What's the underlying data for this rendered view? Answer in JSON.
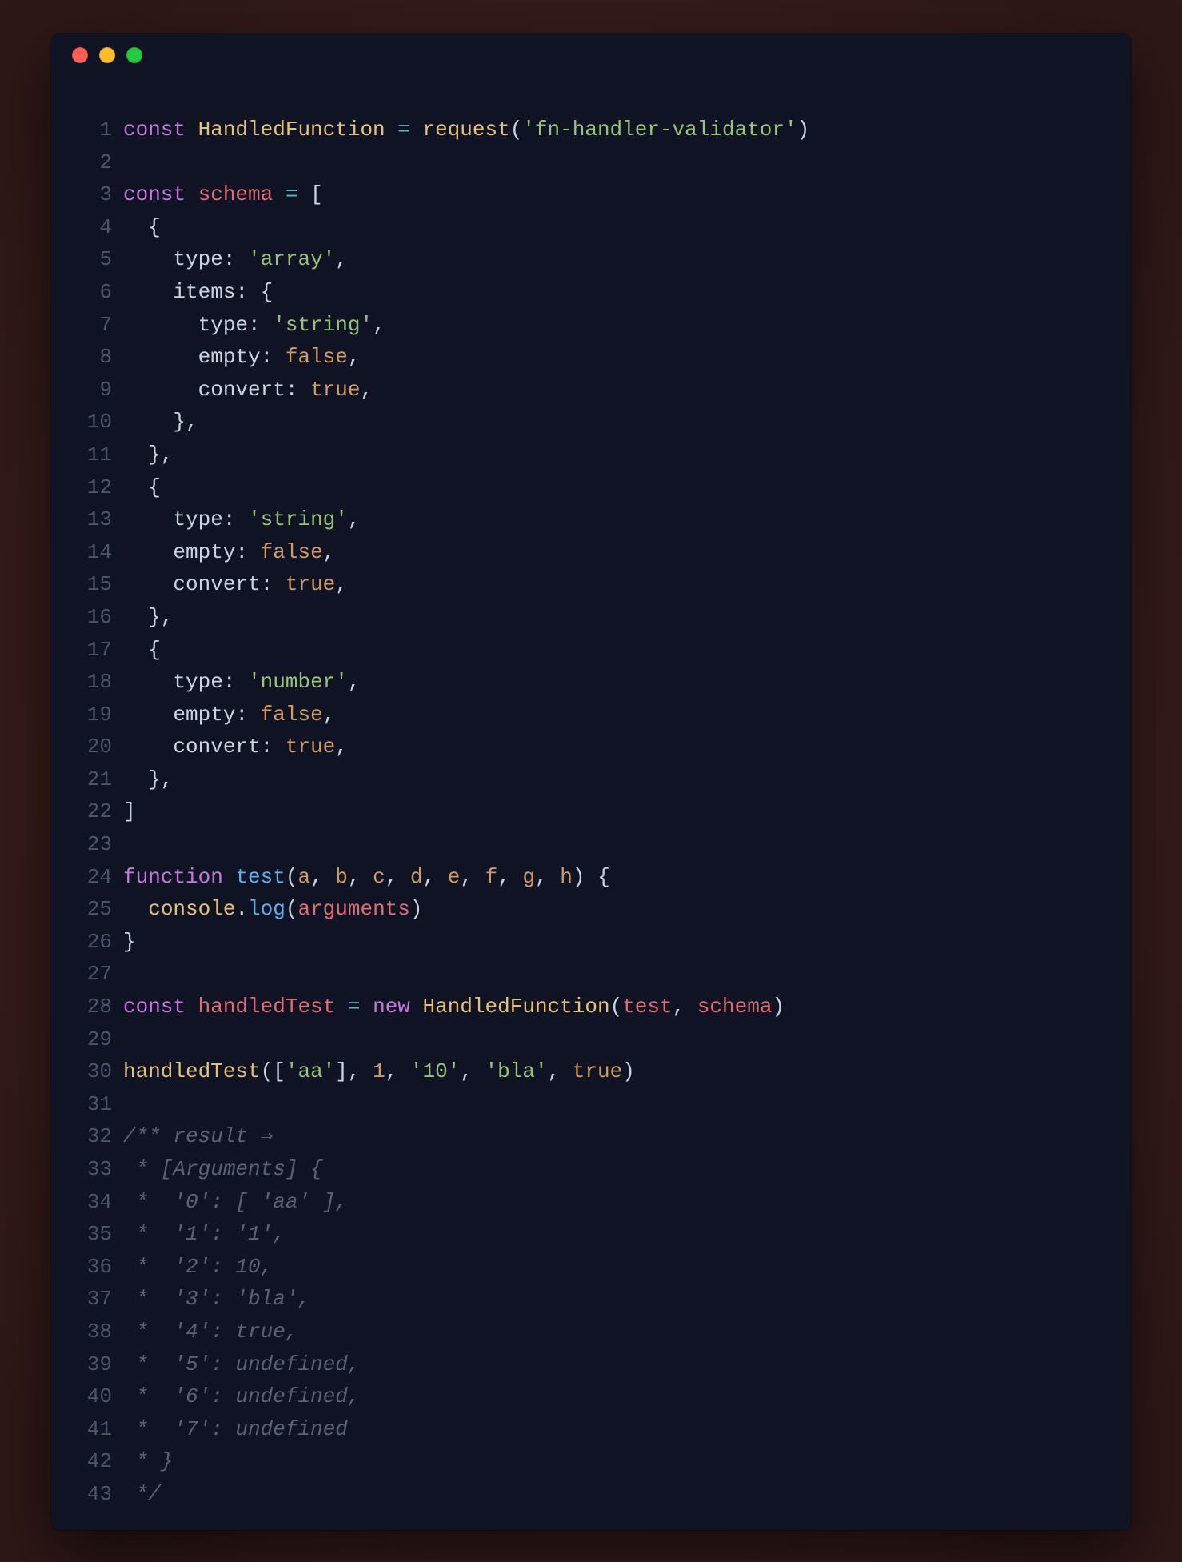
{
  "window": {
    "dots": [
      "red",
      "yellow",
      "green"
    ]
  },
  "code": {
    "lines": [
      {
        "n": "1",
        "tokens": [
          [
            "kw",
            "const"
          ],
          [
            "pun",
            " "
          ],
          [
            "cls",
            "HandledFunction"
          ],
          [
            "pun",
            " "
          ],
          [
            "op",
            "="
          ],
          [
            "pun",
            " "
          ],
          [
            "fncall",
            "request"
          ],
          [
            "pun",
            "("
          ],
          [
            "str",
            "'fn-handler-validator'"
          ],
          [
            "pun",
            ")"
          ]
        ]
      },
      {
        "n": "2",
        "tokens": []
      },
      {
        "n": "3",
        "tokens": [
          [
            "kw",
            "const"
          ],
          [
            "pun",
            " "
          ],
          [
            "var",
            "schema"
          ],
          [
            "pun",
            " "
          ],
          [
            "op",
            "="
          ],
          [
            "pun",
            " ["
          ]
        ]
      },
      {
        "n": "4",
        "tokens": [
          [
            "pun",
            "  {"
          ]
        ]
      },
      {
        "n": "5",
        "tokens": [
          [
            "pun",
            "    "
          ],
          [
            "prop",
            "type"
          ],
          [
            "pun",
            ": "
          ],
          [
            "str",
            "'array'"
          ],
          [
            "pun",
            ","
          ]
        ]
      },
      {
        "n": "6",
        "tokens": [
          [
            "pun",
            "    "
          ],
          [
            "prop",
            "items"
          ],
          [
            "pun",
            ": {"
          ]
        ]
      },
      {
        "n": "7",
        "tokens": [
          [
            "pun",
            "      "
          ],
          [
            "prop",
            "type"
          ],
          [
            "pun",
            ": "
          ],
          [
            "str",
            "'string'"
          ],
          [
            "pun",
            ","
          ]
        ]
      },
      {
        "n": "8",
        "tokens": [
          [
            "pun",
            "      "
          ],
          [
            "prop",
            "empty"
          ],
          [
            "pun",
            ": "
          ],
          [
            "bool",
            "false"
          ],
          [
            "pun",
            ","
          ]
        ]
      },
      {
        "n": "9",
        "tokens": [
          [
            "pun",
            "      "
          ],
          [
            "prop",
            "convert"
          ],
          [
            "pun",
            ": "
          ],
          [
            "bool",
            "true"
          ],
          [
            "pun",
            ","
          ]
        ]
      },
      {
        "n": "10",
        "tokens": [
          [
            "pun",
            "    },"
          ]
        ]
      },
      {
        "n": "11",
        "tokens": [
          [
            "pun",
            "  },"
          ]
        ]
      },
      {
        "n": "12",
        "tokens": [
          [
            "pun",
            "  {"
          ]
        ]
      },
      {
        "n": "13",
        "tokens": [
          [
            "pun",
            "    "
          ],
          [
            "prop",
            "type"
          ],
          [
            "pun",
            ": "
          ],
          [
            "str",
            "'string'"
          ],
          [
            "pun",
            ","
          ]
        ]
      },
      {
        "n": "14",
        "tokens": [
          [
            "pun",
            "    "
          ],
          [
            "prop",
            "empty"
          ],
          [
            "pun",
            ": "
          ],
          [
            "bool",
            "false"
          ],
          [
            "pun",
            ","
          ]
        ]
      },
      {
        "n": "15",
        "tokens": [
          [
            "pun",
            "    "
          ],
          [
            "prop",
            "convert"
          ],
          [
            "pun",
            ": "
          ],
          [
            "bool",
            "true"
          ],
          [
            "pun",
            ","
          ]
        ]
      },
      {
        "n": "16",
        "tokens": [
          [
            "pun",
            "  },"
          ]
        ]
      },
      {
        "n": "17",
        "tokens": [
          [
            "pun",
            "  {"
          ]
        ]
      },
      {
        "n": "18",
        "tokens": [
          [
            "pun",
            "    "
          ],
          [
            "prop",
            "type"
          ],
          [
            "pun",
            ": "
          ],
          [
            "str",
            "'number'"
          ],
          [
            "pun",
            ","
          ]
        ]
      },
      {
        "n": "19",
        "tokens": [
          [
            "pun",
            "    "
          ],
          [
            "prop",
            "empty"
          ],
          [
            "pun",
            ": "
          ],
          [
            "bool",
            "false"
          ],
          [
            "pun",
            ","
          ]
        ]
      },
      {
        "n": "20",
        "tokens": [
          [
            "pun",
            "    "
          ],
          [
            "prop",
            "convert"
          ],
          [
            "pun",
            ": "
          ],
          [
            "bool",
            "true"
          ],
          [
            "pun",
            ","
          ]
        ]
      },
      {
        "n": "21",
        "tokens": [
          [
            "pun",
            "  },"
          ]
        ]
      },
      {
        "n": "22",
        "tokens": [
          [
            "pun",
            "]"
          ]
        ]
      },
      {
        "n": "23",
        "tokens": []
      },
      {
        "n": "24",
        "tokens": [
          [
            "kw",
            "function"
          ],
          [
            "pun",
            " "
          ],
          [
            "fnName",
            "test"
          ],
          [
            "pun",
            "("
          ],
          [
            "arg",
            "a"
          ],
          [
            "pun",
            ", "
          ],
          [
            "arg",
            "b"
          ],
          [
            "pun",
            ", "
          ],
          [
            "arg",
            "c"
          ],
          [
            "pun",
            ", "
          ],
          [
            "arg",
            "d"
          ],
          [
            "pun",
            ", "
          ],
          [
            "arg",
            "e"
          ],
          [
            "pun",
            ", "
          ],
          [
            "arg",
            "f"
          ],
          [
            "pun",
            ", "
          ],
          [
            "arg",
            "g"
          ],
          [
            "pun",
            ", "
          ],
          [
            "arg",
            "h"
          ],
          [
            "pun",
            ") {"
          ]
        ]
      },
      {
        "n": "25",
        "tokens": [
          [
            "pun",
            "  "
          ],
          [
            "cls",
            "console"
          ],
          [
            "pun",
            "."
          ],
          [
            "fnName",
            "log"
          ],
          [
            "pun",
            "("
          ],
          [
            "builtin",
            "arguments"
          ],
          [
            "pun",
            ")"
          ]
        ]
      },
      {
        "n": "26",
        "tokens": [
          [
            "pun",
            "}"
          ]
        ]
      },
      {
        "n": "27",
        "tokens": []
      },
      {
        "n": "28",
        "tokens": [
          [
            "kw",
            "const"
          ],
          [
            "pun",
            " "
          ],
          [
            "var",
            "handledTest"
          ],
          [
            "pun",
            " "
          ],
          [
            "op",
            "="
          ],
          [
            "pun",
            " "
          ],
          [
            "kw",
            "new"
          ],
          [
            "pun",
            " "
          ],
          [
            "cls",
            "HandledFunction"
          ],
          [
            "pun",
            "("
          ],
          [
            "var",
            "test"
          ],
          [
            "pun",
            ", "
          ],
          [
            "var",
            "schema"
          ],
          [
            "pun",
            ")"
          ]
        ]
      },
      {
        "n": "29",
        "tokens": []
      },
      {
        "n": "30",
        "tokens": [
          [
            "fncall",
            "handledTest"
          ],
          [
            "pun",
            "(["
          ],
          [
            "str",
            "'aa'"
          ],
          [
            "pun",
            "], "
          ],
          [
            "num",
            "1"
          ],
          [
            "pun",
            ", "
          ],
          [
            "str",
            "'10'"
          ],
          [
            "pun",
            ", "
          ],
          [
            "str",
            "'bla'"
          ],
          [
            "pun",
            ", "
          ],
          [
            "bool",
            "true"
          ],
          [
            "pun",
            ")"
          ]
        ]
      },
      {
        "n": "31",
        "tokens": []
      },
      {
        "n": "32",
        "tokens": [
          [
            "cmt",
            "/** result ⇒"
          ]
        ]
      },
      {
        "n": "33",
        "tokens": [
          [
            "cmt",
            " * [Arguments] {"
          ]
        ]
      },
      {
        "n": "34",
        "tokens": [
          [
            "cmt",
            " *  '0': [ 'aa' ],"
          ]
        ]
      },
      {
        "n": "35",
        "tokens": [
          [
            "cmt",
            " *  '1': '1',"
          ]
        ]
      },
      {
        "n": "36",
        "tokens": [
          [
            "cmt",
            " *  '2': 10,"
          ]
        ]
      },
      {
        "n": "37",
        "tokens": [
          [
            "cmt",
            " *  '3': 'bla',"
          ]
        ]
      },
      {
        "n": "38",
        "tokens": [
          [
            "cmt",
            " *  '4': true,"
          ]
        ]
      },
      {
        "n": "39",
        "tokens": [
          [
            "cmt",
            " *  '5': undefined,"
          ]
        ]
      },
      {
        "n": "40",
        "tokens": [
          [
            "cmt",
            " *  '6': undefined,"
          ]
        ]
      },
      {
        "n": "41",
        "tokens": [
          [
            "cmt",
            " *  '7': undefined"
          ]
        ]
      },
      {
        "n": "42",
        "tokens": [
          [
            "cmt",
            " * }"
          ]
        ]
      },
      {
        "n": "43",
        "tokens": [
          [
            "cmt",
            " */"
          ]
        ]
      }
    ]
  }
}
